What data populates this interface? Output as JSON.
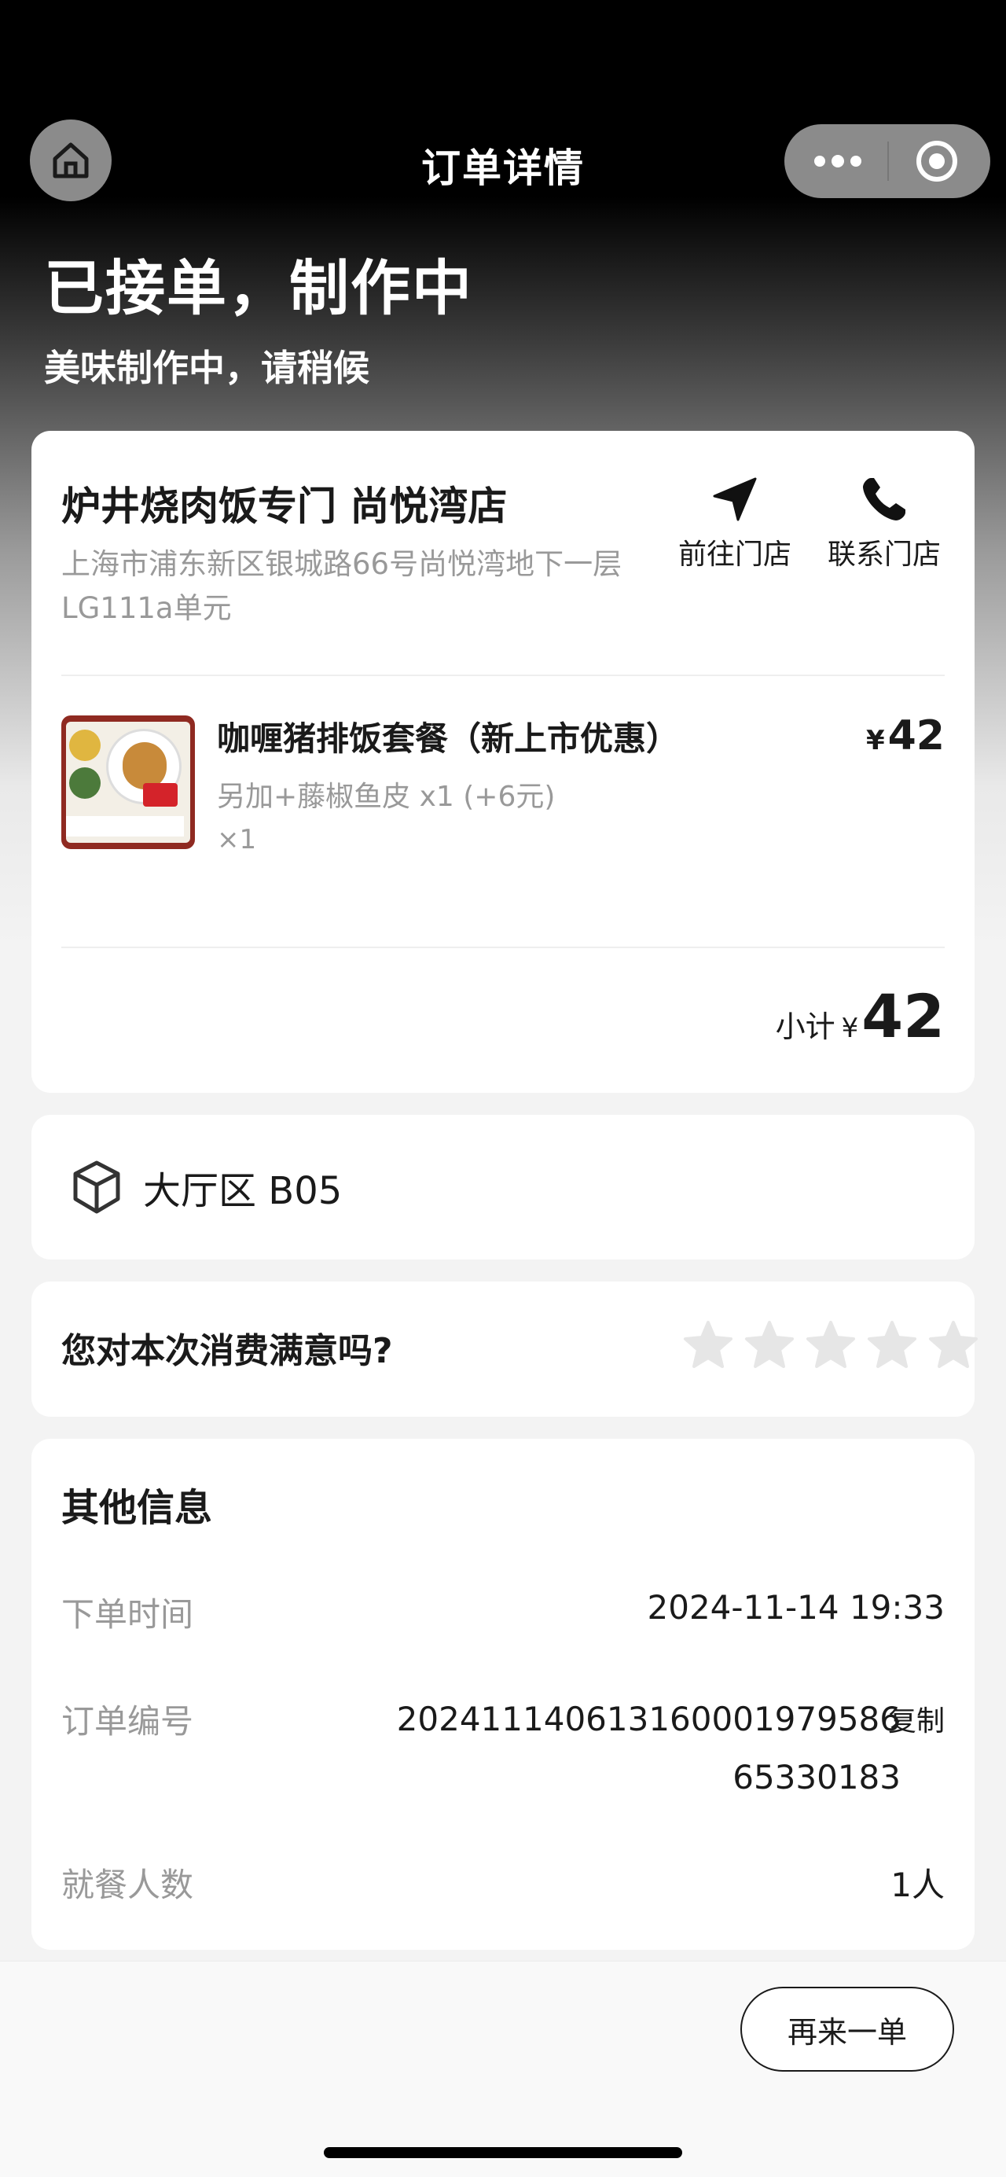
{
  "nav": {
    "title": "订单详情",
    "home_icon": "home-icon",
    "more_icon": "more-dots-icon",
    "close_icon": "target-circle-icon"
  },
  "status": {
    "title": "已接单，制作中",
    "subtitle": "美味制作中，请稍候"
  },
  "store": {
    "name": "炉井烧肉饭专门 尚悦湾店",
    "address": "上海市浦东新区银城路66号尚悦湾地下一层LG111a单元",
    "actions": [
      {
        "label": "前往门店",
        "icon": "navigation-arrow-icon"
      },
      {
        "label": "联系门店",
        "icon": "phone-icon"
      }
    ]
  },
  "order_items": [
    {
      "name": "咖喱猪排饭套餐（新上市优惠）",
      "option": "另加+藤椒鱼皮 x1 (+6元)",
      "quantity": "×1",
      "currency": "¥",
      "price": "42"
    }
  ],
  "subtotal": {
    "label": "小计",
    "currency": "¥",
    "amount": "42"
  },
  "table": {
    "icon": "cube-icon",
    "text": "大厅区 B05"
  },
  "rating": {
    "question": "您对本次消费满意吗?",
    "stars_total": 5,
    "stars_selected": 0,
    "star_color": "#e6e6e6"
  },
  "info": {
    "title": "其他信息",
    "rows": [
      {
        "label": "下单时间",
        "value": "2024-11-14 19:33"
      },
      {
        "label": "订单编号",
        "value": "202411140613160001979586 65330183",
        "action": "复制"
      },
      {
        "label": "就餐人数",
        "value": "1人"
      }
    ]
  },
  "footer": {
    "reorder_label": "再来一单"
  }
}
